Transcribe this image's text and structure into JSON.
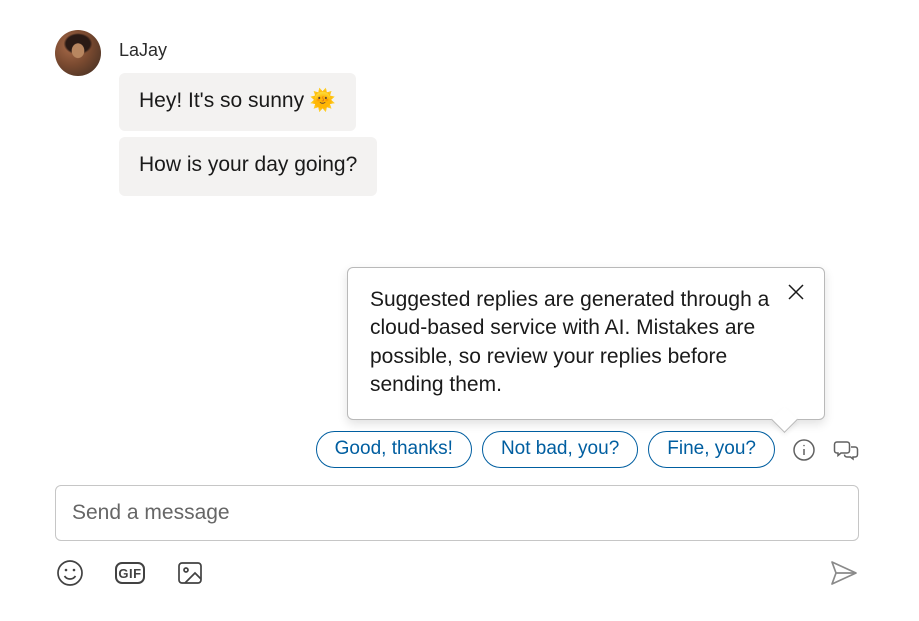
{
  "sender": {
    "name": "LaJay"
  },
  "messages": [
    "Hey! It's so sunny 🌞",
    "How is your day going?"
  ],
  "tooltip": {
    "text": "Suggested replies are generated through a cloud-based service with AI. Mistakes are possible, so review your replies before sending them."
  },
  "suggested_replies": [
    "Good, thanks!",
    "Not bad, you?",
    "Fine, you?"
  ],
  "input": {
    "placeholder": "Send a message"
  },
  "toolbar": {
    "gif_label": "GIF"
  }
}
